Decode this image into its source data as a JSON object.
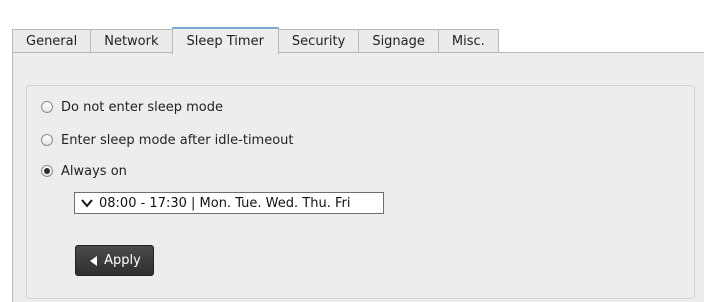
{
  "tabs": [
    {
      "label": "General",
      "active": false
    },
    {
      "label": "Network",
      "active": false
    },
    {
      "label": "Sleep Timer",
      "active": true
    },
    {
      "label": "Security",
      "active": false
    },
    {
      "label": "Signage",
      "active": false
    },
    {
      "label": "Misc.",
      "active": false
    }
  ],
  "sleep_options": [
    {
      "label": "Do not enter sleep mode",
      "selected": false
    },
    {
      "label": "Enter sleep mode after idle-timeout",
      "selected": false
    },
    {
      "label": "Always on",
      "selected": true
    }
  ],
  "schedule": {
    "value": "08:00 - 17:30 | Mon. Tue. Wed. Thu. Fri"
  },
  "apply_button": {
    "label": "Apply",
    "icon": "chevron-left-icon"
  },
  "colors": {
    "active_tab_accent": "#7ba7d6",
    "panel_background": "#efedeb",
    "apply_background": "#3a3a3a"
  }
}
